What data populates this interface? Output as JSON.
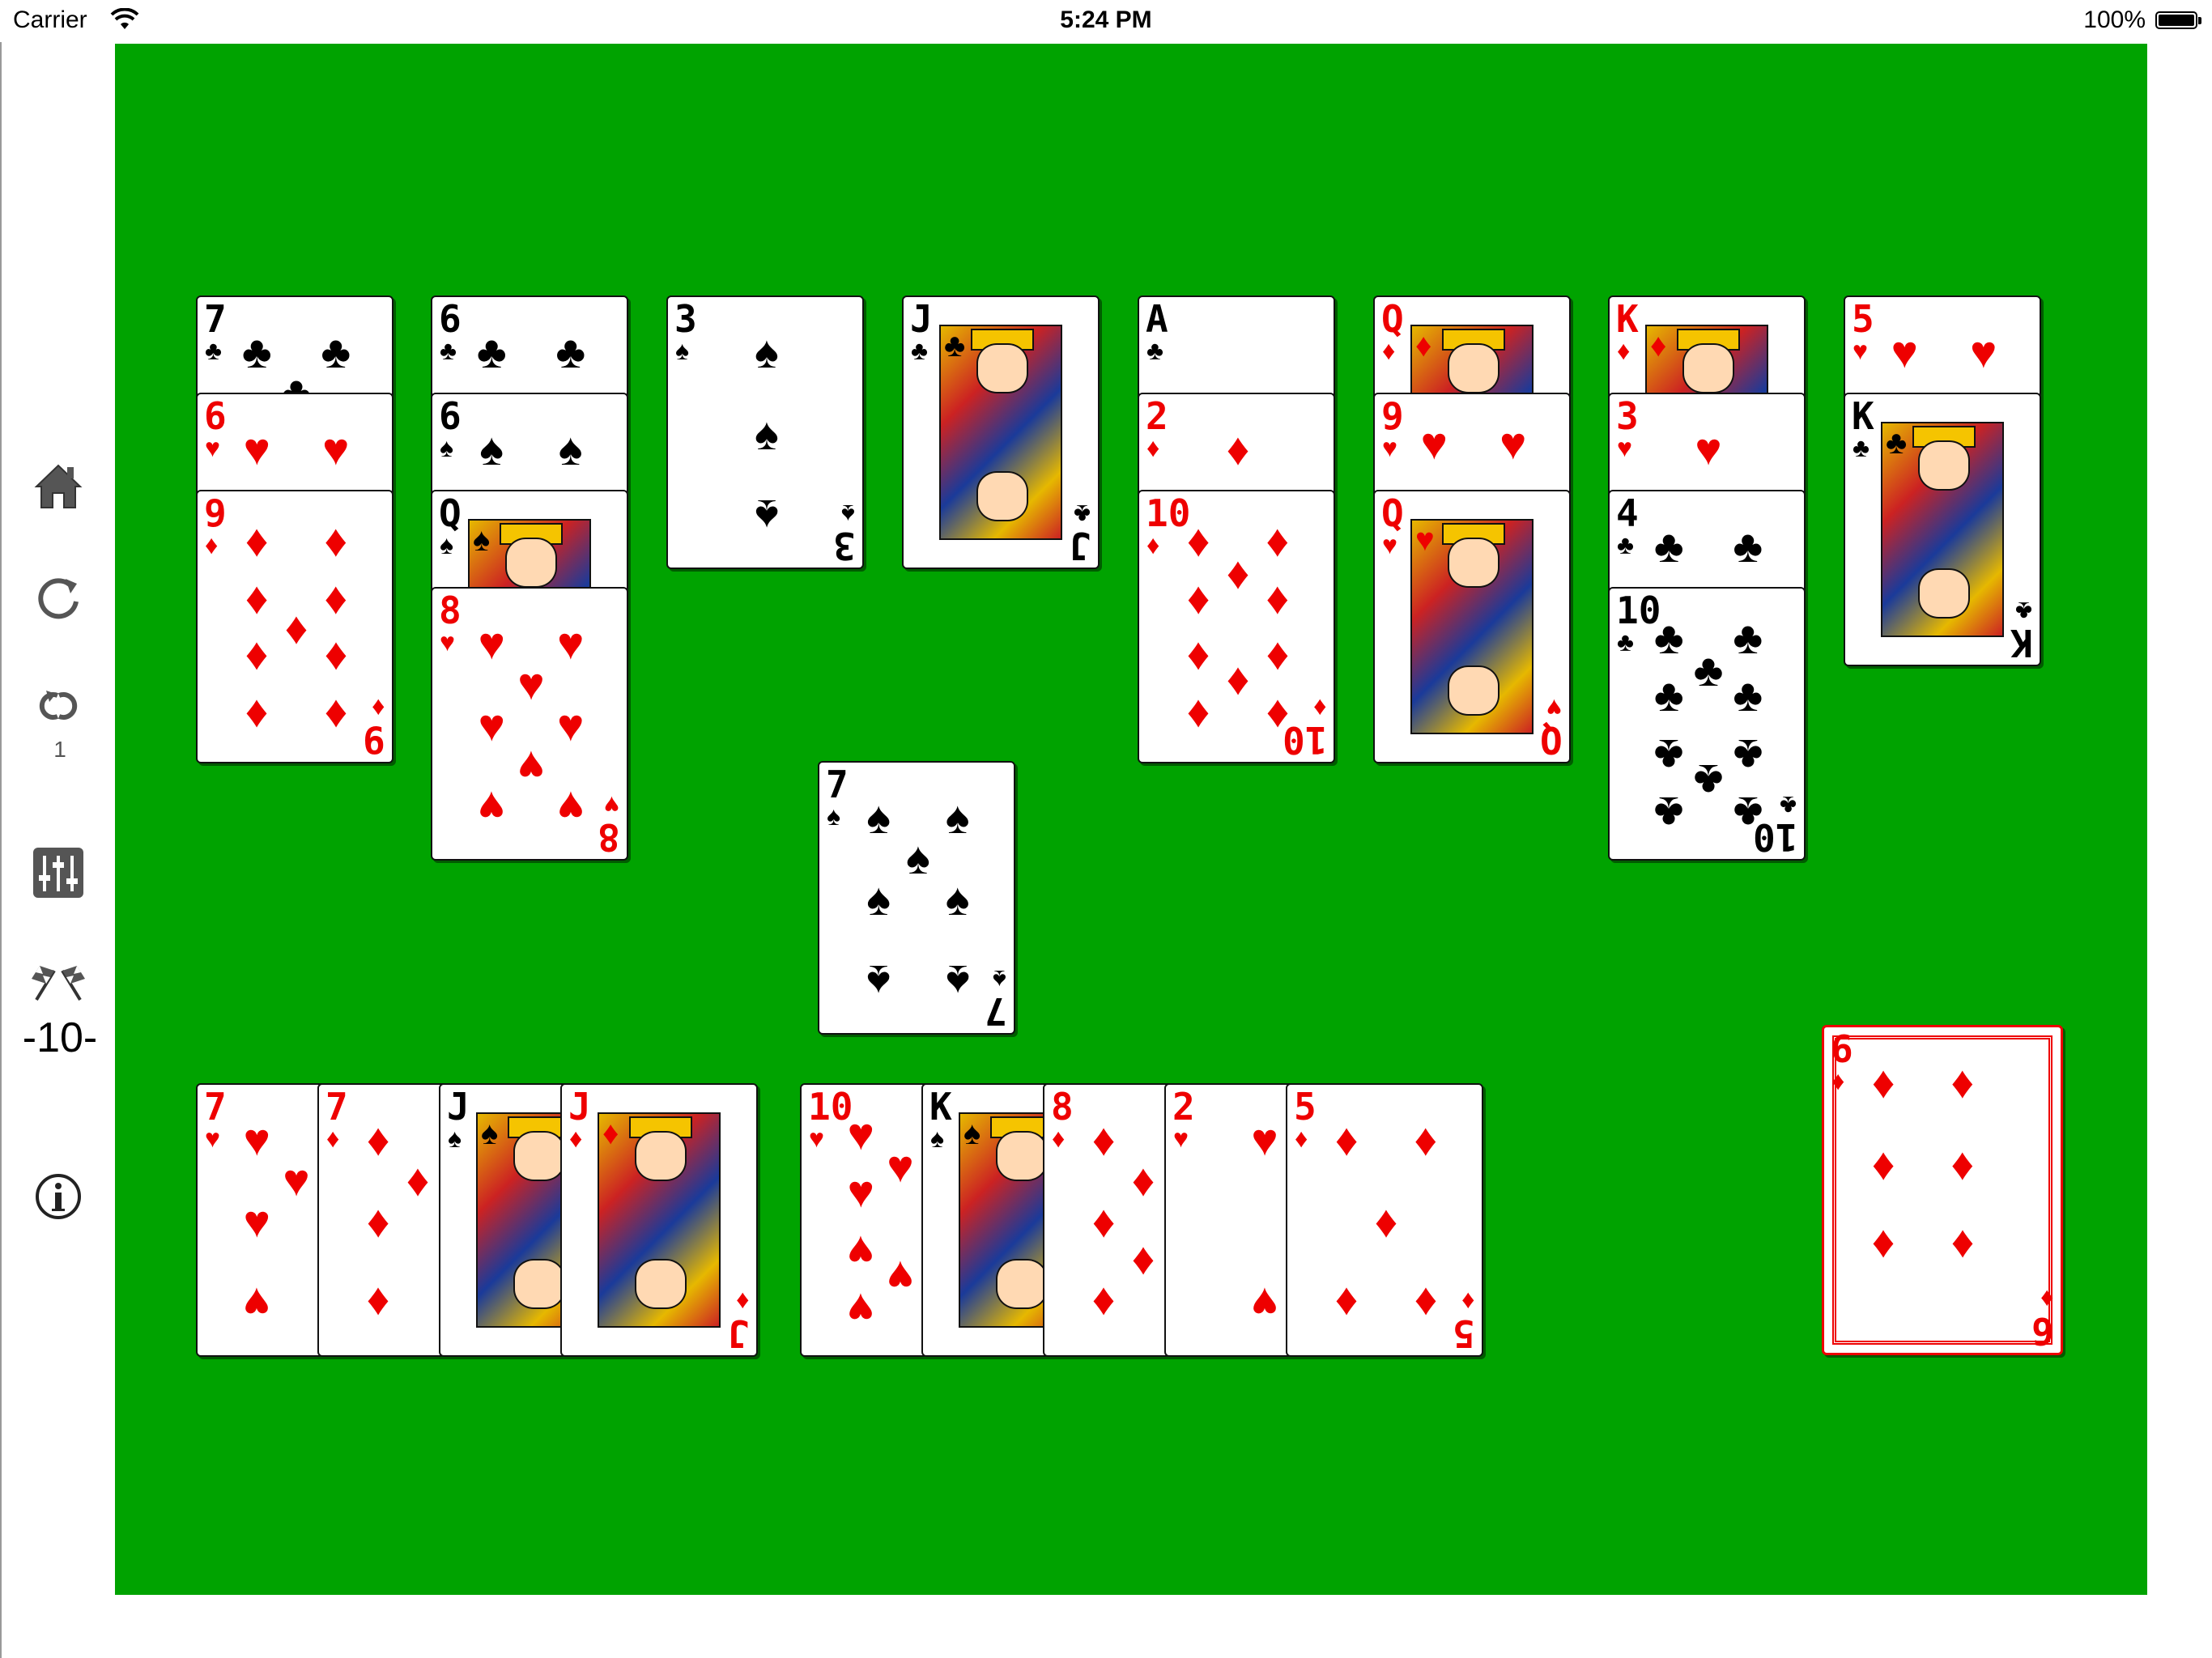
{
  "status_bar": {
    "carrier": "Carrier",
    "time": "5:24 PM",
    "battery": "100%",
    "icons": [
      "wifi-icon",
      "battery-icon"
    ]
  },
  "sidebar": {
    "buttons": [
      {
        "name": "home",
        "icon": "home-icon"
      },
      {
        "name": "restart",
        "icon": "restart-icon"
      },
      {
        "name": "redeal",
        "icon": "redeal-icon"
      },
      {
        "name": "settings",
        "icon": "sliders-icon"
      },
      {
        "name": "finish",
        "icon": "checkered-flags-icon"
      },
      {
        "name": "info",
        "icon": "info-icon"
      }
    ],
    "redeal_count": "1",
    "score": "-10-"
  },
  "colors": {
    "table_green": "#00a300",
    "red_suit": "#ee0000",
    "black_suit": "#000000"
  },
  "tableau": [
    {
      "column": 1,
      "cards": [
        {
          "rank": "7",
          "suit": "♣",
          "color": "black"
        },
        {
          "rank": "6",
          "suit": "♥",
          "color": "red"
        },
        {
          "rank": "9",
          "suit": "♦",
          "color": "red"
        }
      ]
    },
    {
      "column": 2,
      "cards": [
        {
          "rank": "6",
          "suit": "♣",
          "color": "black"
        },
        {
          "rank": "6",
          "suit": "♠",
          "color": "black"
        },
        {
          "rank": "Q",
          "suit": "♠",
          "color": "black"
        },
        {
          "rank": "8",
          "suit": "♥",
          "color": "red"
        }
      ]
    },
    {
      "column": 3,
      "cards": [
        {
          "rank": "3",
          "suit": "♠",
          "color": "black"
        }
      ]
    },
    {
      "column": 4,
      "cards": [
        {
          "rank": "J",
          "suit": "♣",
          "color": "black"
        }
      ]
    },
    {
      "column": 5,
      "cards": [
        {
          "rank": "A",
          "suit": "♣",
          "color": "black"
        },
        {
          "rank": "2",
          "suit": "♦",
          "color": "red"
        },
        {
          "rank": "10",
          "suit": "♦",
          "color": "red"
        }
      ]
    },
    {
      "column": 6,
      "cards": [
        {
          "rank": "Q",
          "suit": "♦",
          "color": "red"
        },
        {
          "rank": "9",
          "suit": "♥",
          "color": "red"
        },
        {
          "rank": "Q",
          "suit": "♥",
          "color": "red"
        }
      ]
    },
    {
      "column": 7,
      "cards": [
        {
          "rank": "K",
          "suit": "♦",
          "color": "red"
        },
        {
          "rank": "3",
          "suit": "♥",
          "color": "red"
        },
        {
          "rank": "4",
          "suit": "♣",
          "color": "black"
        },
        {
          "rank": "10",
          "suit": "♣",
          "color": "black"
        }
      ]
    },
    {
      "column": 8,
      "cards": [
        {
          "rank": "5",
          "suit": "♥",
          "color": "red"
        },
        {
          "rank": "K",
          "suit": "♣",
          "color": "black"
        }
      ]
    }
  ],
  "waste": {
    "rank": "7",
    "suit": "♠",
    "color": "black"
  },
  "reserve_left": [
    {
      "rank": "7",
      "suit": "♥",
      "color": "red"
    },
    {
      "rank": "7",
      "suit": "♦",
      "color": "red"
    },
    {
      "rank": "J",
      "suit": "♠",
      "color": "black"
    },
    {
      "rank": "J",
      "suit": "♦",
      "color": "red"
    }
  ],
  "reserve_right": [
    {
      "rank": "10",
      "suit": "♥",
      "color": "red"
    },
    {
      "rank": "K",
      "suit": "♠",
      "color": "black"
    },
    {
      "rank": "8",
      "suit": "♦",
      "color": "red"
    },
    {
      "rank": "2",
      "suit": "♥",
      "color": "red"
    },
    {
      "rank": "5",
      "suit": "♦",
      "color": "red"
    }
  ],
  "stock": {
    "rank": "6",
    "suit": "♦",
    "color": "red"
  }
}
